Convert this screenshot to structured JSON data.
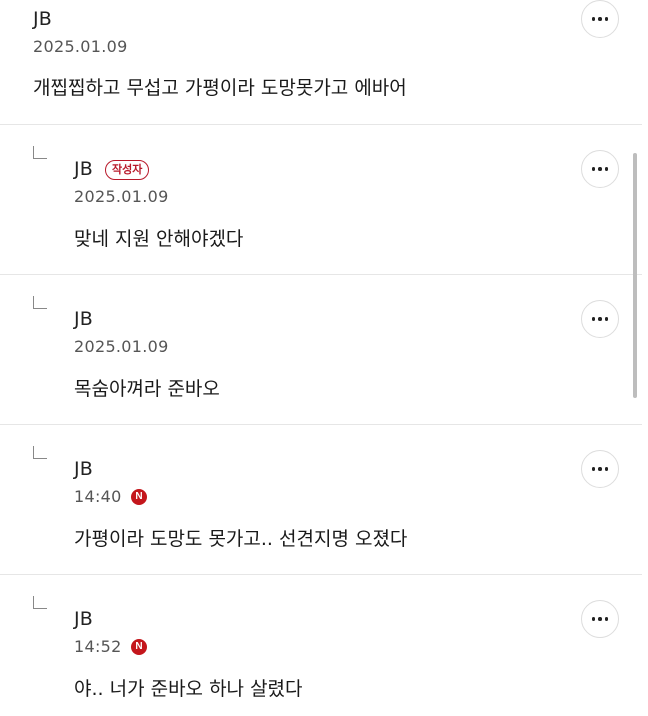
{
  "comments": [
    {
      "author": "JB",
      "date": "2025.01.09",
      "text": "개찝찝하고 무섭고 가평이라 도망못가고 에바어",
      "more_icon": "more-horizontal-icon"
    },
    {
      "author": "JB",
      "badge": "작성자",
      "date": "2025.01.09",
      "text": "맞네 지원 안해야겠다",
      "reply_icon": "reply-arrow-icon",
      "more_icon": "more-horizontal-icon"
    },
    {
      "author": "JB",
      "date": "2025.01.09",
      "text": "목숨아껴라 준바오",
      "reply_icon": "reply-arrow-icon",
      "more_icon": "more-horizontal-icon"
    },
    {
      "author": "JB",
      "date": "14:40",
      "new_badge": "N",
      "text": "가평이라 도망도 못가고.. 선견지명 오졌다",
      "reply_icon": "reply-arrow-icon",
      "more_icon": "more-horizontal-icon"
    },
    {
      "author": "JB",
      "date": "14:52",
      "new_badge": "N",
      "text": "야.. 너가 준바오 하나 살렸다",
      "reply_icon": "reply-arrow-icon",
      "more_icon": "more-horizontal-icon"
    }
  ],
  "colors": {
    "accent_red": "#c4161c",
    "badge_red": "#b8192a",
    "divider": "#e6e6e6",
    "meta_text": "#555555"
  }
}
